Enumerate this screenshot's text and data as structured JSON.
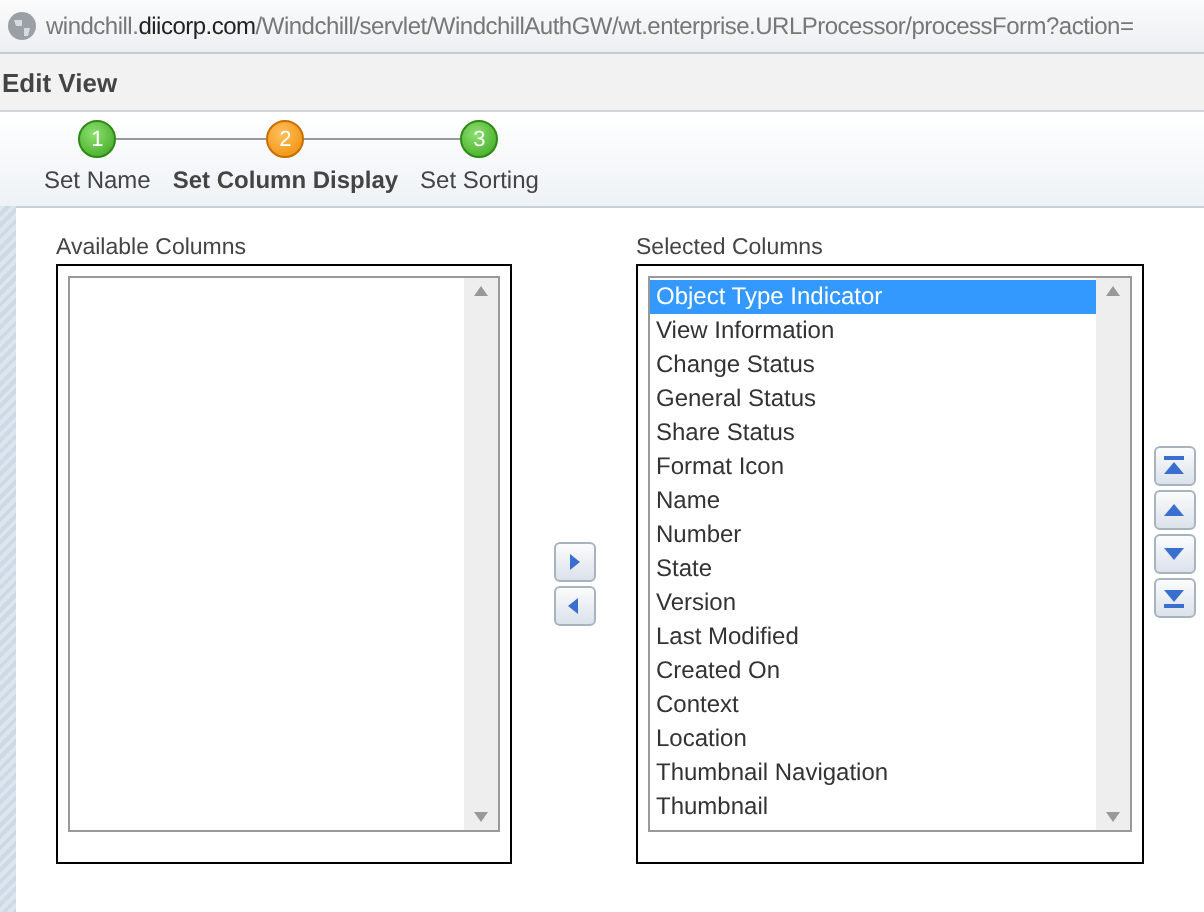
{
  "address_bar": {
    "url": "windchill.**diicorp.com**/Windchill/servlet/WindchillAuthGW/wt.enterprise.URLProcessor/processForm?action="
  },
  "window": {
    "title": "Edit View"
  },
  "steps": [
    {
      "number": "1",
      "label": "Set Name",
      "selected": false
    },
    {
      "number": "2",
      "label": "Set Column Display",
      "selected": true
    },
    {
      "number": "3",
      "label": "Set Sorting",
      "selected": false
    }
  ],
  "available_columns": {
    "label": "Available Columns"
  },
  "selected_columns": {
    "label": "Selected Columns",
    "items": [
      {
        "label": "Object Type Indicator",
        "selected": true
      },
      {
        "label": "View Information",
        "selected": false
      },
      {
        "label": "Change Status",
        "selected": false
      },
      {
        "label": "General Status",
        "selected": false
      },
      {
        "label": "Share Status",
        "selected": false
      },
      {
        "label": "Format Icon",
        "selected": false
      },
      {
        "label": "Name",
        "selected": false
      },
      {
        "label": "Number",
        "selected": false
      },
      {
        "label": "State",
        "selected": false
      },
      {
        "label": "Version",
        "selected": false
      },
      {
        "label": "Last Modified",
        "selected": false
      },
      {
        "label": "Created On",
        "selected": false
      },
      {
        "label": "Context",
        "selected": false
      },
      {
        "label": "Location",
        "selected": false
      },
      {
        "label": "Thumbnail Navigation",
        "selected": false
      },
      {
        "label": "Thumbnail",
        "selected": false
      }
    ]
  }
}
